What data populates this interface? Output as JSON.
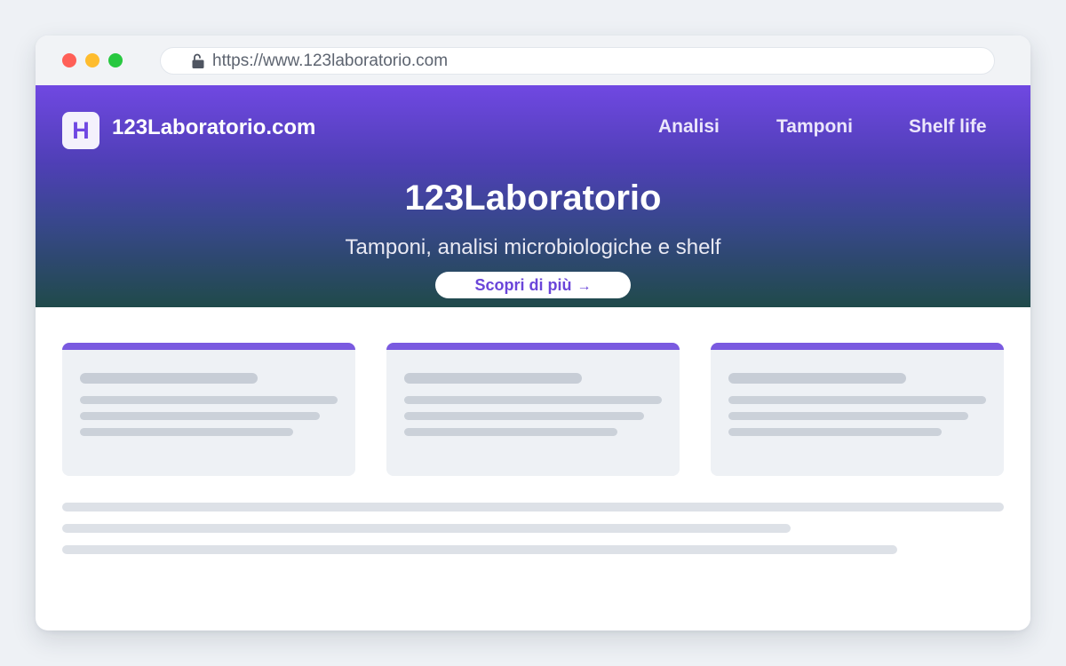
{
  "browser": {
    "url": "https://www.123laboratorio.com"
  },
  "header": {
    "logo_letter": "H",
    "brand": "123Laboratorio.com",
    "nav": [
      {
        "label": "Analisi"
      },
      {
        "label": "Tamponi"
      },
      {
        "label": "Shelf life"
      }
    ]
  },
  "hero": {
    "title": "123Laboratorio",
    "subtitle": "Tamponi, analisi microbiologiche e shelf",
    "cta_label": "Scopri di più",
    "cta_arrow": "→"
  },
  "colors": {
    "accent": "#7048e2",
    "card_accent": "#7a5ae0",
    "hero_bottom": "#204a4a"
  },
  "icons": {
    "lock": "lock-icon",
    "cta_arrow": "arrow-right-icon"
  }
}
